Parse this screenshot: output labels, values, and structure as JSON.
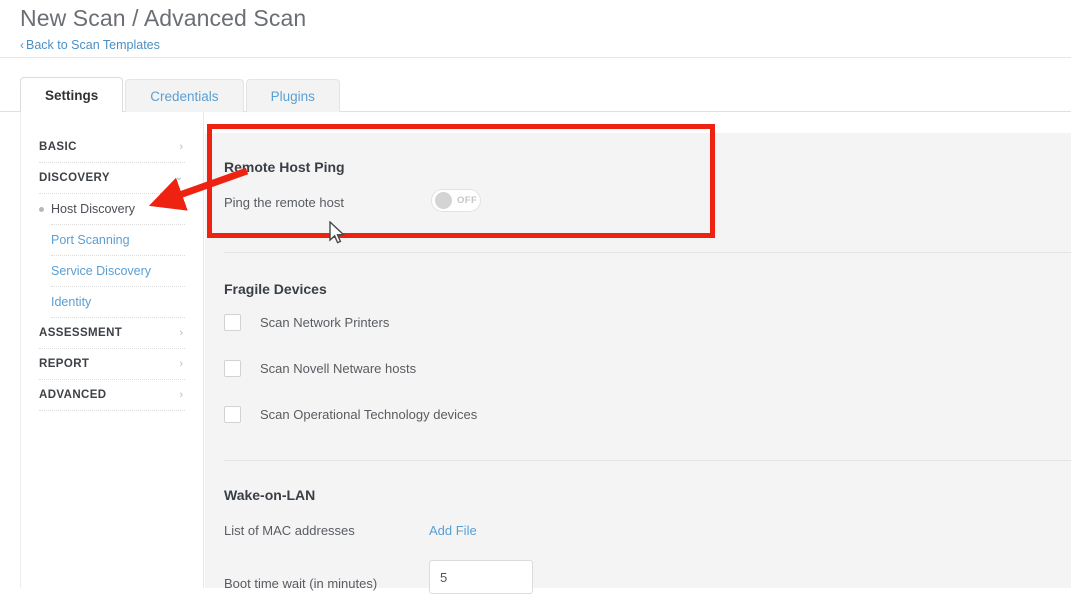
{
  "header": {
    "title": "New Scan / Advanced Scan",
    "back_link": "Back to Scan Templates",
    "back_chevron": "‹"
  },
  "tabs": [
    {
      "label": "Settings",
      "state": "active"
    },
    {
      "label": "Credentials",
      "state": "inactive"
    },
    {
      "label": "Plugins",
      "state": "inactive"
    }
  ],
  "sidebar": {
    "items": [
      {
        "label": "BASIC",
        "chevron": "›",
        "expanded": false
      },
      {
        "label": "DISCOVERY",
        "chevron": "⌄",
        "expanded": true
      },
      {
        "label": "ASSESSMENT",
        "chevron": "›",
        "expanded": false
      },
      {
        "label": "REPORT",
        "chevron": "›",
        "expanded": false
      },
      {
        "label": "ADVANCED",
        "chevron": "›",
        "expanded": false
      }
    ],
    "sub_items": [
      {
        "label": "Host Discovery",
        "active": true
      },
      {
        "label": "Port Scanning",
        "active": false
      },
      {
        "label": "Service Discovery",
        "active": false
      },
      {
        "label": "Identity",
        "active": false
      }
    ]
  },
  "main": {
    "remote_host_ping": {
      "title": "Remote Host Ping",
      "row_label": "Ping the remote host",
      "toggle_state": "OFF"
    },
    "fragile_devices": {
      "title": "Fragile Devices",
      "checkboxes": [
        {
          "label": "Scan Network Printers",
          "checked": false
        },
        {
          "label": "Scan Novell Netware hosts",
          "checked": false
        },
        {
          "label": "Scan Operational Technology devices",
          "checked": false
        }
      ]
    },
    "wake_on_lan": {
      "title": "Wake-on-LAN",
      "mac_label": "List of MAC addresses",
      "add_file_label": "Add File",
      "boot_label": "Boot time wait (in minutes)",
      "boot_value": "5"
    }
  },
  "colors": {
    "link_blue": "#5a9fd4",
    "annotation_red": "#ee2211",
    "content_bg": "#f4f4f4"
  }
}
